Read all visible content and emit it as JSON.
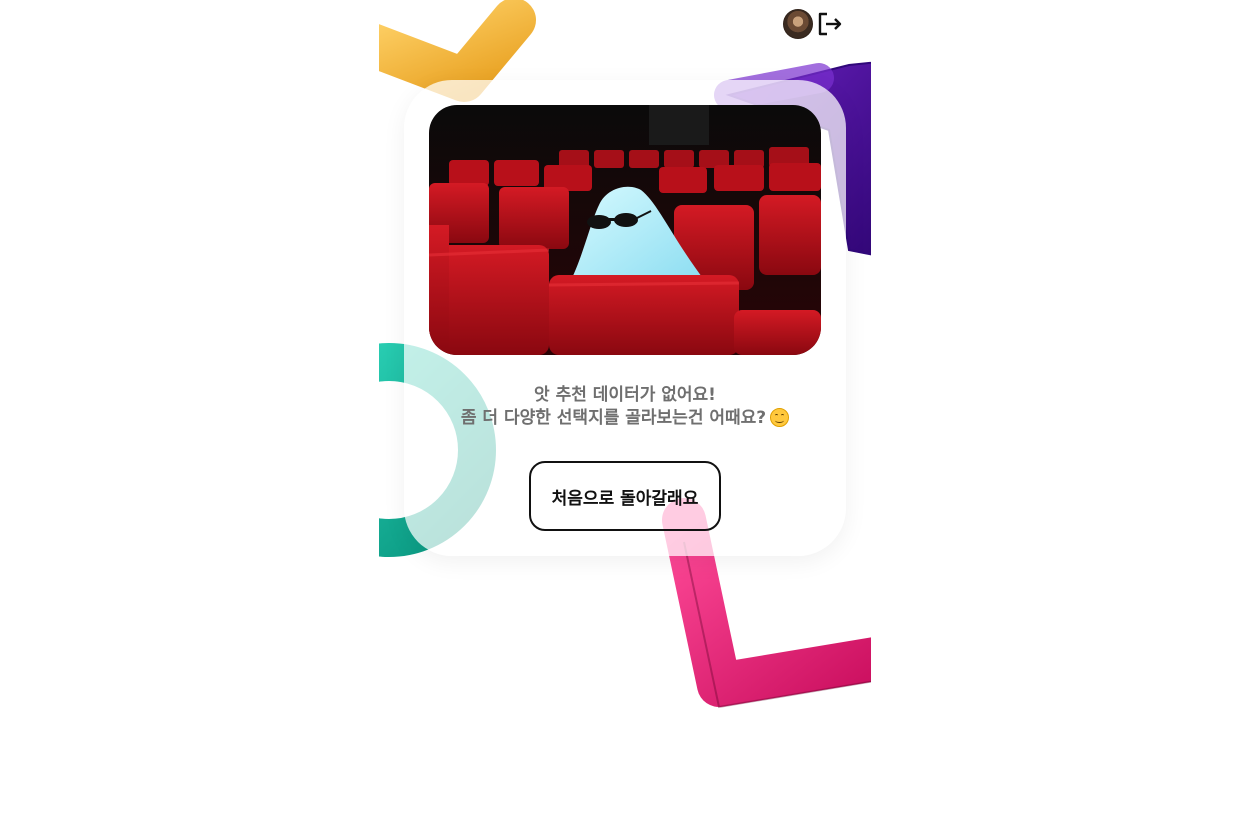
{
  "header": {
    "avatar_icon": "user-avatar-icon",
    "logout_icon": "logout-icon"
  },
  "empty_state": {
    "image_icon": "ghost-in-cinema-illustration",
    "message_line1": "앗 추천 데이터가 없어요!",
    "message_line2": "좀 더 다양한 선택지를 골라보는건 어때요?",
    "emoji_icon": "smiling-face-icon",
    "back_button_label": "처음으로 돌아갈래요"
  },
  "colors": {
    "background": "#ffffff",
    "message_text": "#6f6f6f",
    "button_border": "#111111",
    "deco_yellow": "#f2b63c",
    "deco_purple": "#4a1090",
    "deco_teal": "#12b59a",
    "deco_pink": "#f0207a",
    "seat_red": "#b8101a"
  }
}
